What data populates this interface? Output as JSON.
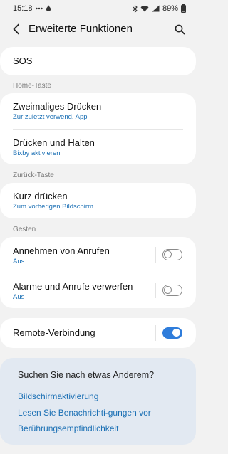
{
  "status_bar": {
    "time": "15:18",
    "battery": "89%",
    "left_icons": [
      "notification-dots-icon",
      "flame-icon"
    ],
    "right_icons": [
      "bluetooth-icon",
      "wifi-icon",
      "signal-icon",
      "battery-icon"
    ]
  },
  "header": {
    "title": "Erweiterte Funktionen"
  },
  "sos": {
    "label": "SOS"
  },
  "home_section": {
    "label": "Home-Taste",
    "items": [
      {
        "label": "Zweimaliges Drücken",
        "sub": "Zur zuletzt verwend. App"
      },
      {
        "label": "Drücken und Halten",
        "sub": "Bixby aktivieren"
      }
    ]
  },
  "back_section": {
    "label": "Zurück-Taste",
    "items": [
      {
        "label": "Kurz drücken",
        "sub": "Zum vorherigen Bildschirm"
      }
    ]
  },
  "gestures_section": {
    "label": "Gesten",
    "items": [
      {
        "label": "Annehmen von Anrufen",
        "sub": "Aus",
        "toggle": "off"
      },
      {
        "label": "Alarme und Anrufe verwerfen",
        "sub": "Aus",
        "toggle": "off"
      }
    ]
  },
  "remote": {
    "label": "Remote-Verbindung",
    "toggle": "on"
  },
  "suggestions": {
    "title": "Suchen Sie nach etwas Anderem?",
    "links": [
      "Bildschirmaktivierung",
      "Lesen Sie Benachrichti-gungen vor",
      "Berührungsempfindlichkeit"
    ]
  },
  "colors": {
    "accent": "#2f7ddb",
    "link": "#1a6fb4",
    "background": "#f2f2f2",
    "suggest_bg": "#e2e9f2"
  }
}
